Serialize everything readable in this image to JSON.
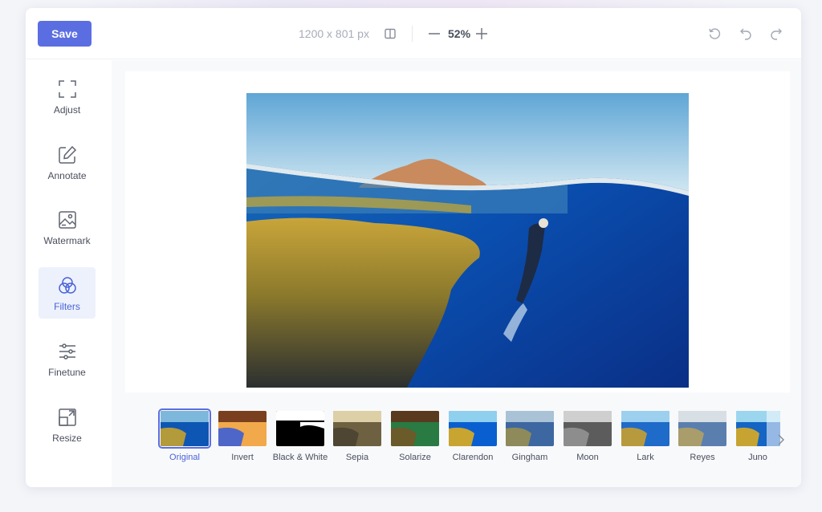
{
  "header": {
    "save_label": "Save",
    "dimensions": "1200 x 801 px",
    "zoom": "52%"
  },
  "sidebar": {
    "items": [
      {
        "label": "Adjust",
        "icon": "crop-icon"
      },
      {
        "label": "Annotate",
        "icon": "pencil-icon"
      },
      {
        "label": "Watermark",
        "icon": "image-icon"
      },
      {
        "label": "Filters",
        "icon": "filters-icon",
        "active": true
      },
      {
        "label": "Finetune",
        "icon": "sliders-icon"
      },
      {
        "label": "Resize",
        "icon": "resize-icon"
      }
    ]
  },
  "filters": {
    "items": [
      {
        "label": "Original",
        "selected": true
      },
      {
        "label": "Invert"
      },
      {
        "label": "Black & White"
      },
      {
        "label": "Sepia"
      },
      {
        "label": "Solarize"
      },
      {
        "label": "Clarendon"
      },
      {
        "label": "Gingham"
      },
      {
        "label": "Moon"
      },
      {
        "label": "Lark"
      },
      {
        "label": "Reyes"
      },
      {
        "label": "Juno"
      }
    ]
  },
  "colors": {
    "accent": "#5b6ee1",
    "active_bg": "#edf1fb"
  }
}
